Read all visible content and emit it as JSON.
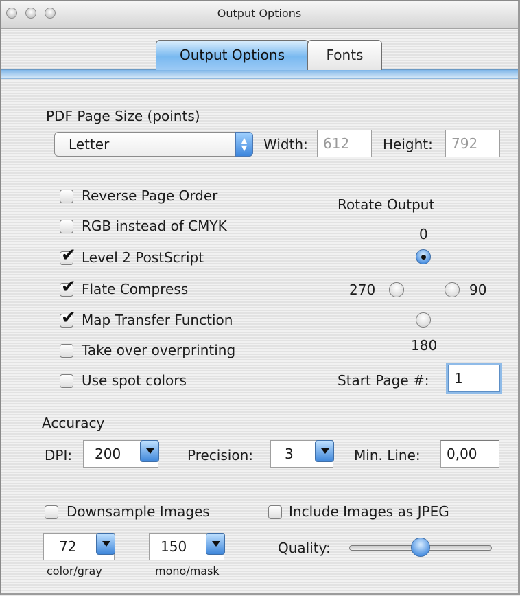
{
  "window": {
    "title": "Output Options"
  },
  "tabs": [
    {
      "label": "Output Options",
      "active": true
    },
    {
      "label": "Fonts",
      "active": false
    }
  ],
  "page_size": {
    "section_label": "PDF Page Size (points)",
    "selected": "Letter",
    "width_label": "Width:",
    "width_value": "612",
    "height_label": "Height:",
    "height_value": "792"
  },
  "options": [
    {
      "label": "Reverse Page Order",
      "checked": false
    },
    {
      "label": "RGB instead of CMYK",
      "checked": false
    },
    {
      "label": "Level 2 PostScript",
      "checked": true
    },
    {
      "label": "Flate Compress",
      "checked": true
    },
    {
      "label": "Map Transfer Function",
      "checked": true
    },
    {
      "label": "Take over overprinting",
      "checked": false
    },
    {
      "label": "Use spot colors",
      "checked": false
    }
  ],
  "rotate": {
    "title": "Rotate Output",
    "top": "0",
    "left": "270",
    "right": "90",
    "bottom": "180",
    "selected": "0"
  },
  "start_page": {
    "label": "Start Page #:",
    "value": "1"
  },
  "accuracy": {
    "section_label": "Accuracy",
    "dpi_label": "DPI:",
    "dpi_value": "200",
    "precision_label": "Precision:",
    "precision_value": "3",
    "minline_label": "Min. Line:",
    "minline_value": "0,00"
  },
  "images": {
    "downsample_label": "Downsample Images",
    "downsample_checked": false,
    "jpeg_label": "Include Images as JPEG",
    "jpeg_checked": false,
    "color_value": "72",
    "color_caption": "color/gray",
    "mono_value": "150",
    "mono_caption": "mono/mask",
    "quality_label": "Quality:",
    "quality_fraction": 0.5
  },
  "icons": {
    "check": "checkmark-icon",
    "popup_arrows": "updown-arrows-icon",
    "combo_arrow": "chevron-down-icon"
  }
}
